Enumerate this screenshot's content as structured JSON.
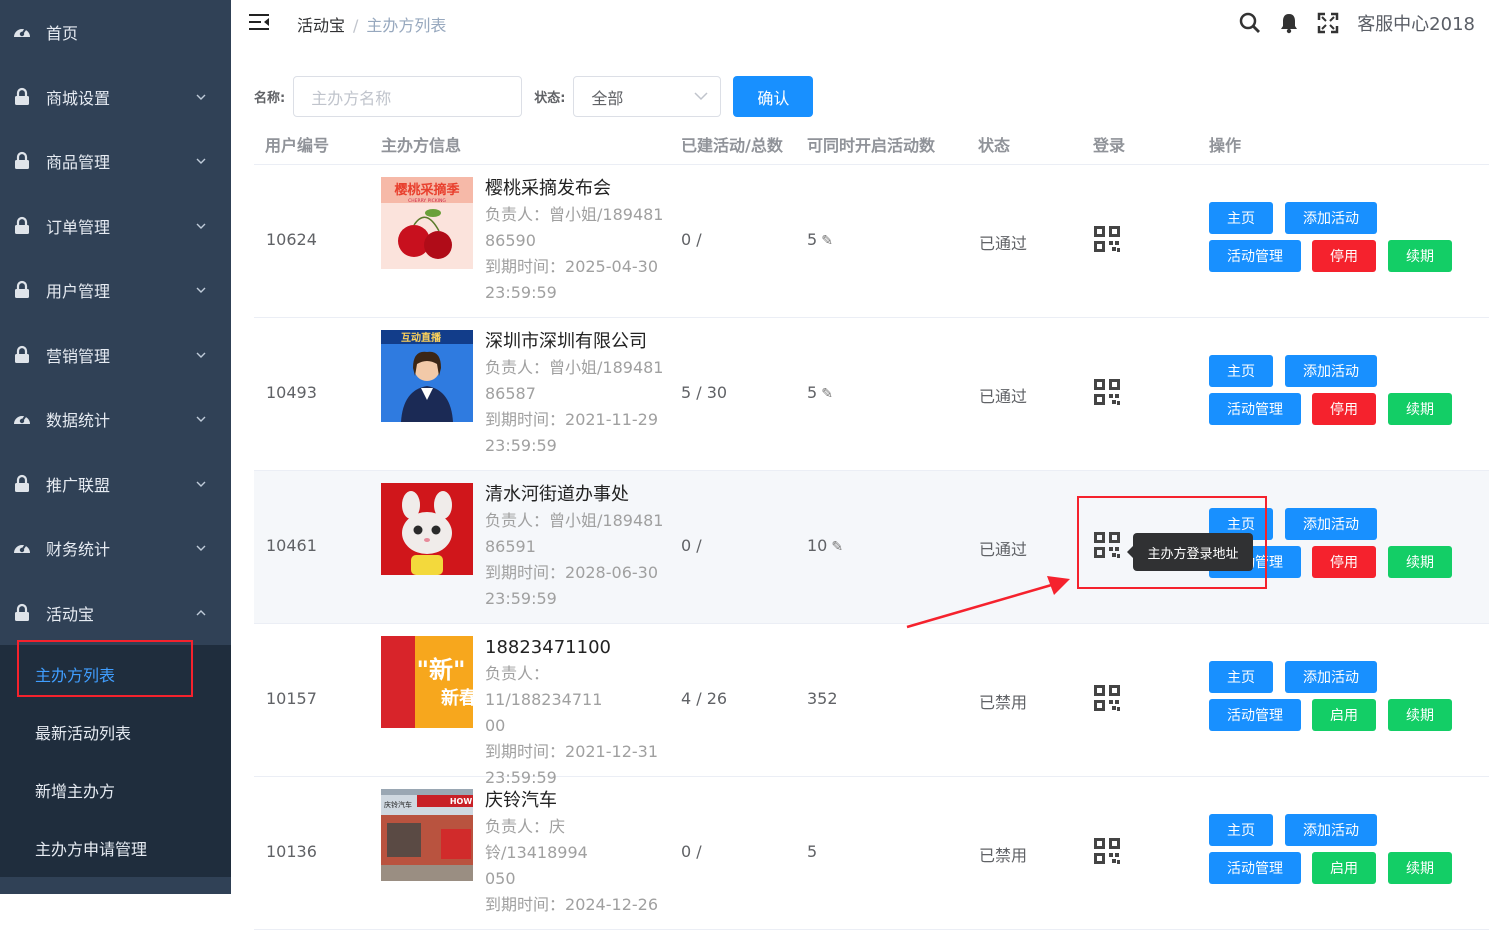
{
  "sidebar": {
    "items": [
      {
        "label": "首页",
        "icon": "dashboard-icon",
        "expandable": false
      },
      {
        "label": "商城设置",
        "icon": "lock-icon",
        "expandable": true
      },
      {
        "label": "商品管理",
        "icon": "lock-icon",
        "expandable": true
      },
      {
        "label": "订单管理",
        "icon": "lock-icon",
        "expandable": true
      },
      {
        "label": "用户管理",
        "icon": "lock-icon",
        "expandable": true
      },
      {
        "label": "营销管理",
        "icon": "lock-icon",
        "expandable": true
      },
      {
        "label": "数据统计",
        "icon": "dashboard-icon",
        "expandable": true
      },
      {
        "label": "推广联盟",
        "icon": "lock-icon",
        "expandable": true
      },
      {
        "label": "财务统计",
        "icon": "dashboard-icon",
        "expandable": true
      },
      {
        "label": "活动宝",
        "icon": "lock-icon",
        "expandable": true,
        "open": true
      }
    ],
    "subitems": [
      {
        "label": "主办方列表",
        "active": true
      },
      {
        "label": "最新活动列表",
        "active": false
      },
      {
        "label": "新增主办方",
        "active": false
      },
      {
        "label": "主办方申请管理",
        "active": false
      }
    ]
  },
  "breadcrumb": {
    "parent": "活动宝",
    "separator": "/",
    "current": "主办方列表"
  },
  "header": {
    "user": "客服中心2018"
  },
  "filters": {
    "name_label": "名称:",
    "name_placeholder": "主办方名称",
    "status_label": "状态:",
    "status_value": "全部",
    "confirm": "确认"
  },
  "table": {
    "headers": {
      "user_id": "用户编号",
      "info": "主办方信息",
      "activities": "已建活动/总数",
      "concurrent": "可同时开启活动数",
      "status": "状态",
      "login": "登录",
      "ops": "操作"
    },
    "labels": {
      "manager": "负责人：",
      "expire": "到期时间："
    },
    "buttons": {
      "home": "主页",
      "add": "添加活动",
      "manage": "活动管理",
      "disable": "停用",
      "enable": "启用",
      "renew": "续期"
    },
    "rows": [
      {
        "id": "10624",
        "name": "樱桃采摘发布会",
        "manager_a": "曾小姐/189481",
        "manager_b": "86590",
        "expire_a": "2025-04-30",
        "expire_b": "23:59:59",
        "activities": "0 /",
        "concurrent": "5",
        "editable": true,
        "status": "已通过",
        "toggle": "停用"
      },
      {
        "id": "10493",
        "name": "深圳市深圳有限公司",
        "manager_a": "曾小姐/189481",
        "manager_b": "86587",
        "expire_a": "2021-11-29",
        "expire_b": "23:59:59",
        "activities": "5 / 30",
        "concurrent": "5",
        "editable": true,
        "status": "已通过",
        "toggle": "停用"
      },
      {
        "id": "10461",
        "name": "清水河街道办事处",
        "manager_a": "曾小姐/189481",
        "manager_b": "86591",
        "expire_a": "2028-06-30",
        "expire_b": "23:59:59",
        "activities": "0 /",
        "concurrent": "10",
        "editable": true,
        "status": "已通过",
        "toggle": "停用"
      },
      {
        "id": "10157",
        "name": "18823471100",
        "manager_a": "11/188234711",
        "manager_b": "00",
        "expire_a": "2021-12-31",
        "expire_b": "23:59:59",
        "activities": "4 / 26",
        "concurrent": "352",
        "editable": false,
        "status": "已禁用",
        "toggle": "启用"
      },
      {
        "id": "10136",
        "name": "庆铃汽车",
        "manager_a": "庆铃/13418994",
        "manager_b": "050",
        "expire_a": "2024-12-26",
        "expire_b": "",
        "activities": "0 /",
        "concurrent": "5",
        "editable": false,
        "status": "已禁用",
        "toggle": "启用"
      }
    ]
  },
  "tooltip": {
    "text": "主办方登录地址"
  },
  "thumbnails": {
    "cherry": {
      "title": "樱桃采摘季",
      "sub": "CHERRY PICKING"
    },
    "presenter": {
      "title": "互动直播"
    },
    "new_year": {
      "title": "\"新\"",
      "sub": "新春"
    },
    "garage": {
      "title": "庆铃汽车",
      "sub": "HOW"
    }
  },
  "colors": {
    "sidebar": "#304156",
    "submenu": "#1f2d3d",
    "primary": "#1890ff",
    "danger": "#f5222d",
    "success": "#13ce66",
    "annotation": "#f5222d"
  }
}
